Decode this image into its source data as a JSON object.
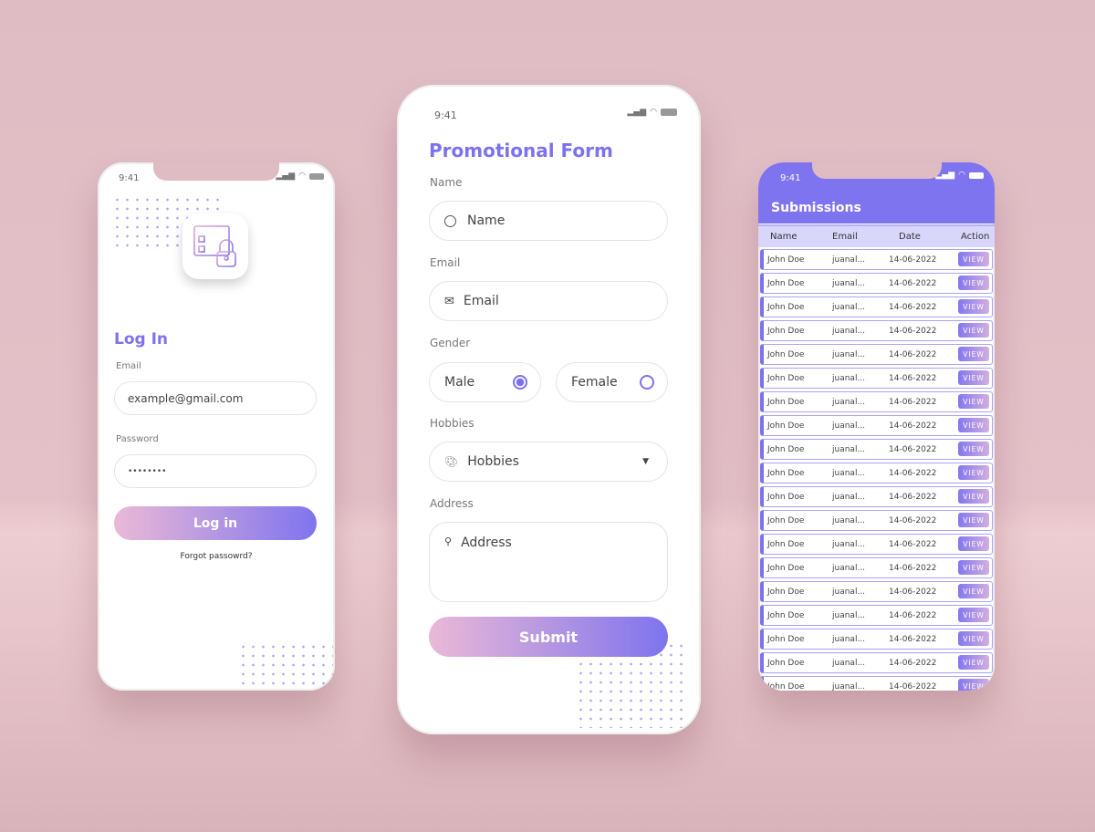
{
  "status_time": "9:41",
  "login": {
    "title": "Log In",
    "email_label": "Email",
    "email_value": "example@gmail.com",
    "password_label": "Password",
    "password_value": "••••••••",
    "login_button": "Log in",
    "forgot": "Forgot passowrd?"
  },
  "form": {
    "title": "Promotional Form",
    "name_label": "Name",
    "name_placeholder": "Name",
    "email_label": "Email",
    "email_placeholder": "Email",
    "gender_label": "Gender",
    "gender_options": [
      {
        "label": "Male",
        "selected": true
      },
      {
        "label": "Female",
        "selected": false
      }
    ],
    "hobbies_label": "Hobbies",
    "hobbies_placeholder": "Hobbies",
    "address_label": "Address",
    "address_placeholder": "Address",
    "submit": "Submit"
  },
  "submissions": {
    "title": "Submissions",
    "columns": [
      "Name",
      "Email",
      "Date",
      "Action"
    ],
    "rows": [
      [
        "John Doe",
        "juanal...",
        "14-06-2022",
        "VIEW"
      ],
      [
        "John Doe",
        "juanal...",
        "14-06-2022",
        "VIEW"
      ],
      [
        "John Doe",
        "juanal...",
        "14-06-2022",
        "VIEW"
      ],
      [
        "John Doe",
        "juanal...",
        "14-06-2022",
        "VIEW"
      ],
      [
        "John Doe",
        "juanal...",
        "14-06-2022",
        "VIEW"
      ],
      [
        "John Doe",
        "juanal...",
        "14-06-2022",
        "VIEW"
      ],
      [
        "John Doe",
        "juanal...",
        "14-06-2022",
        "VIEW"
      ],
      [
        "John Doe",
        "juanal...",
        "14-06-2022",
        "VIEW"
      ],
      [
        "John Doe",
        "juanal...",
        "14-06-2022",
        "VIEW"
      ],
      [
        "John Doe",
        "juanal...",
        "14-06-2022",
        "VIEW"
      ],
      [
        "John Doe",
        "juanal...",
        "14-06-2022",
        "VIEW"
      ],
      [
        "John Doe",
        "juanal...",
        "14-06-2022",
        "VIEW"
      ],
      [
        "John Doe",
        "juanal...",
        "14-06-2022",
        "VIEW"
      ],
      [
        "John Doe",
        "juanal...",
        "14-06-2022",
        "VIEW"
      ],
      [
        "John Doe",
        "juanal...",
        "14-06-2022",
        "VIEW"
      ],
      [
        "John Doe",
        "juanal...",
        "14-06-2022",
        "VIEW"
      ],
      [
        "John Doe",
        "juanal...",
        "14-06-2022",
        "VIEW"
      ],
      [
        "John Doe",
        "juanal...",
        "14-06-2022",
        "VIEW"
      ],
      [
        "John Doe",
        "juanal...",
        "14-06-2022",
        "VIEW"
      ]
    ]
  },
  "colors": {
    "accent": "#7d72ee",
    "gradient_start": "#eab9d6",
    "header_bg": "#7f74ef",
    "table_head_bg": "#d9d6fb"
  }
}
